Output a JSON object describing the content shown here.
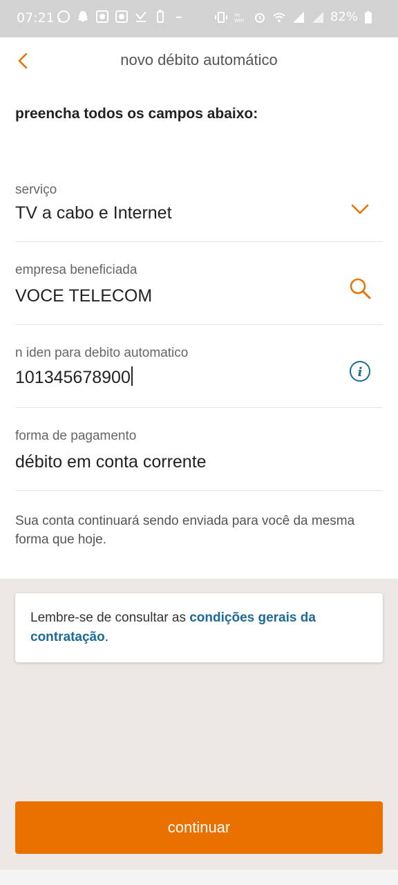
{
  "status_bar": {
    "time": "07:21",
    "battery": "82%",
    "left_icons": [
      "whatsapp-icon",
      "snapchat-icon",
      "app-icon",
      "app-icon",
      "download-icon",
      "battery-saver-icon",
      "dash-icon"
    ],
    "right_icons": [
      "vibrate-icon",
      "vowifi-icon",
      "alarm-icon",
      "wifi-icon",
      "signal-icon",
      "signal-icon",
      "battery-icon"
    ]
  },
  "header": {
    "title": "novo débito automático"
  },
  "form": {
    "instruction": "preencha todos os campos abaixo:",
    "service": {
      "label": "serviço",
      "value": "TV a cabo e Internet"
    },
    "company": {
      "label": "empresa beneficiada",
      "value": "VOCE TELECOM"
    },
    "id_number": {
      "label": "n iden para debito automatico",
      "value": "101345678900"
    },
    "payment": {
      "label": "forma de pagamento",
      "value": "débito em conta corrente"
    },
    "note": "Sua conta continuará sendo enviada para você da mesma forma que hoje."
  },
  "info_card": {
    "prefix": "Lembre-se de consultar as ",
    "link": "condições gerais da contratação",
    "suffix": "."
  },
  "actions": {
    "continue": "continuar"
  },
  "colors": {
    "accent": "#ea7100",
    "link": "#1b6a9a",
    "info": "#1b6a9a"
  }
}
